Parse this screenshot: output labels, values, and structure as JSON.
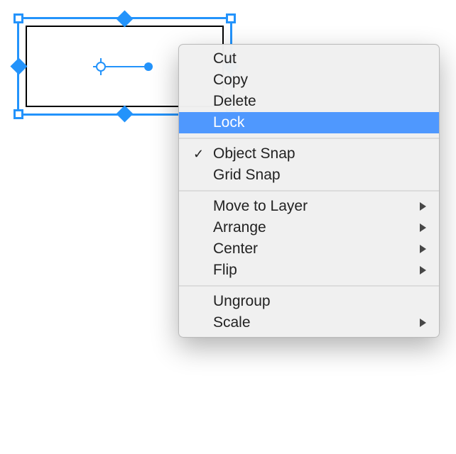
{
  "selection": {
    "color_accent": "#2393fb"
  },
  "menu": {
    "groups": [
      [
        {
          "key": "cut",
          "label": "Cut",
          "checked": false,
          "submenu": false,
          "highlighted": false
        },
        {
          "key": "copy",
          "label": "Copy",
          "checked": false,
          "submenu": false,
          "highlighted": false
        },
        {
          "key": "delete",
          "label": "Delete",
          "checked": false,
          "submenu": false,
          "highlighted": false
        },
        {
          "key": "lock",
          "label": "Lock",
          "checked": false,
          "submenu": false,
          "highlighted": true
        }
      ],
      [
        {
          "key": "object-snap",
          "label": "Object Snap",
          "checked": true,
          "submenu": false,
          "highlighted": false
        },
        {
          "key": "grid-snap",
          "label": "Grid Snap",
          "checked": false,
          "submenu": false,
          "highlighted": false
        }
      ],
      [
        {
          "key": "move-to-layer",
          "label": "Move to Layer",
          "checked": false,
          "submenu": true,
          "highlighted": false
        },
        {
          "key": "arrange",
          "label": "Arrange",
          "checked": false,
          "submenu": true,
          "highlighted": false
        },
        {
          "key": "center",
          "label": "Center",
          "checked": false,
          "submenu": true,
          "highlighted": false
        },
        {
          "key": "flip",
          "label": "Flip",
          "checked": false,
          "submenu": true,
          "highlighted": false
        }
      ],
      [
        {
          "key": "ungroup",
          "label": "Ungroup",
          "checked": false,
          "submenu": false,
          "highlighted": false
        },
        {
          "key": "scale",
          "label": "Scale",
          "checked": false,
          "submenu": true,
          "highlighted": false
        }
      ]
    ]
  }
}
